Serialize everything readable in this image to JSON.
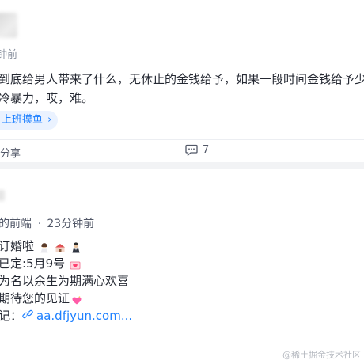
{
  "post1": {
    "time": "钟前",
    "content_lines": [
      "到底给男人带来了什么，无休止的金钱给予，如果一段时间金钱给予少了，",
      "冷暴力，哎，难。"
    ],
    "tag": "上班摸鱼",
    "share_label": "分享",
    "comment_count": "7"
  },
  "post2": {
    "author": "的前端",
    "separator": "·",
    "time": "23分钟前",
    "lines": [
      {
        "text": "订婚啦"
      },
      {
        "text": "已定:5月9号"
      },
      {
        "text": "为名以余生为期满心欢喜"
      },
      {
        "text": "期待您的见证"
      },
      {
        "prefix": "记：",
        "link": "aa.dfjyun.com..."
      }
    ]
  },
  "watermark": "@稀土掘金技术社区",
  "colors": {
    "accent": "#1e80ff",
    "tag_bg": "#eaf2ff",
    "muted": "#8a919f",
    "page_bg": "#f2f3f5"
  }
}
